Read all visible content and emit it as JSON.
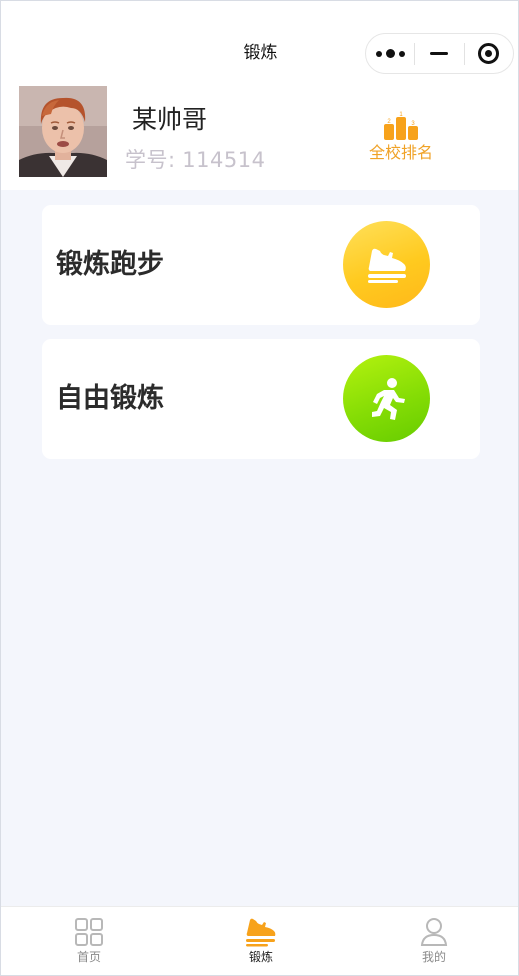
{
  "navbar": {
    "title": "锻炼",
    "menu_icon": "more-dots-icon",
    "minimize_icon": "minimize-icon",
    "close_icon": "target-close-icon"
  },
  "profile": {
    "name": "某帅哥",
    "student_id_label": "学号:",
    "student_id": "114514",
    "rank_label": "全校排名",
    "rank_icon": "podium-icon"
  },
  "cards": [
    {
      "title": "锻炼跑步",
      "icon": "sneaker-icon",
      "accent": "#ffc21f"
    },
    {
      "title": "自由锻炼",
      "icon": "running-person-icon",
      "accent": "#7fd800"
    }
  ],
  "tabbar": {
    "items": [
      {
        "label": "首页",
        "icon": "grid-icon",
        "active": false
      },
      {
        "label": "锻炼",
        "icon": "sneaker-icon",
        "active": true
      },
      {
        "label": "我的",
        "icon": "user-icon",
        "active": false
      }
    ],
    "active_color": "#f7a21b"
  },
  "colors": {
    "page_background": "#f4f6fc",
    "rank_orange": "#f0a227",
    "id_gray": "#c7c2cc"
  }
}
